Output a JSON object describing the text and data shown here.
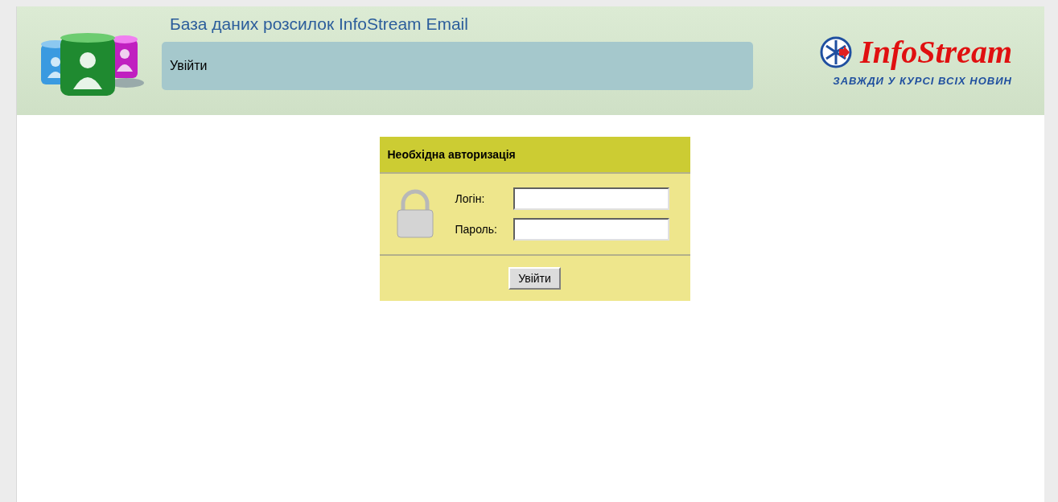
{
  "header": {
    "title": "База даних розсилок InfoStream Email",
    "page_title": "Увійти",
    "logo": {
      "name": "InfoStream",
      "tagline": "ЗАВЖДИ У КУРСІ ВСІХ НОВИН"
    }
  },
  "login": {
    "heading": "Необхідна авторизація",
    "fields": [
      {
        "label": "Логін:"
      },
      {
        "label": "Пароль:"
      }
    ],
    "button": "Увійти"
  }
}
